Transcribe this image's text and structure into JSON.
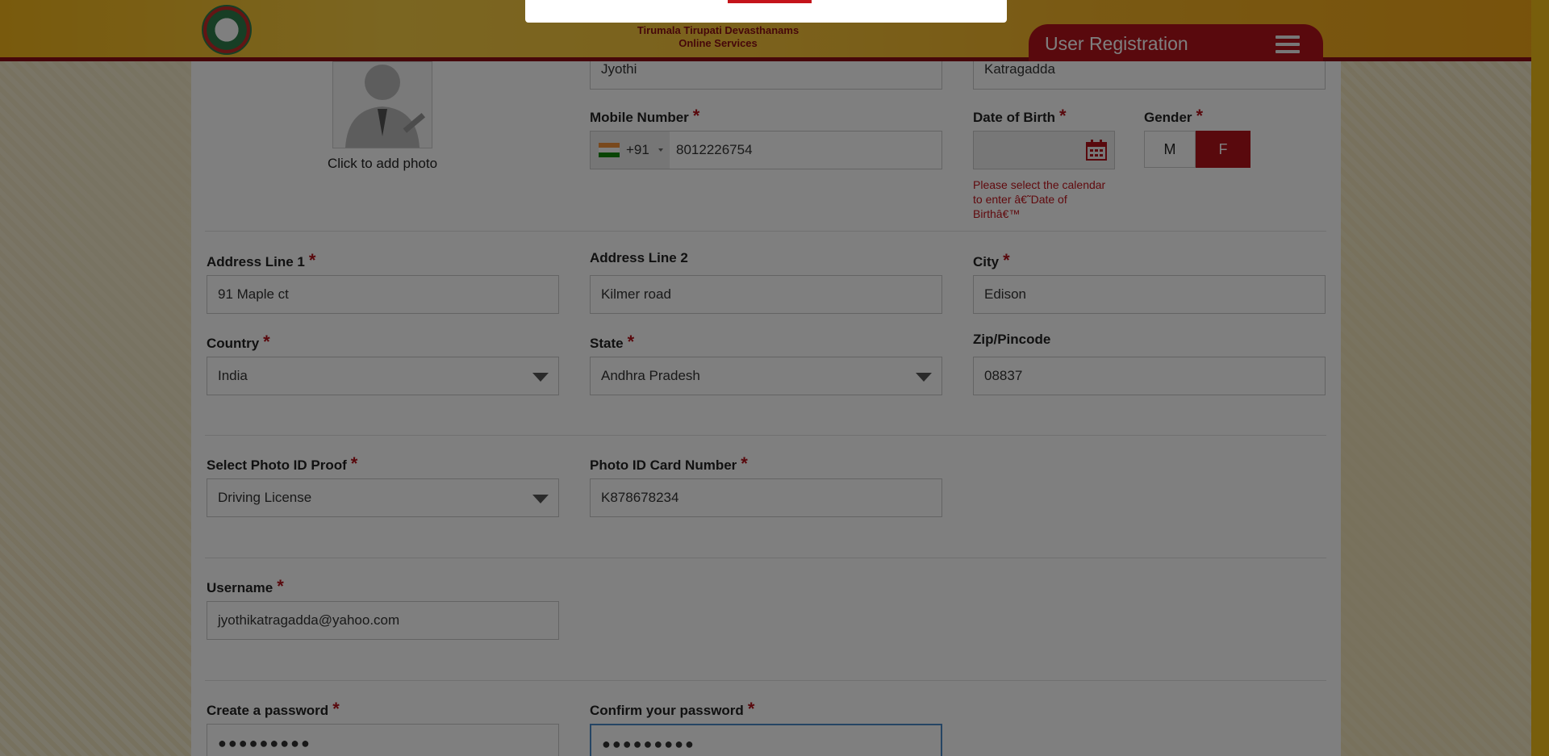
{
  "header": {
    "org_line1": "Tirumala Tirupati Devasthanams",
    "org_line2": "Online Services",
    "page_title": "User Registration"
  },
  "photo": {
    "caption": "Click to add photo"
  },
  "form": {
    "first_name_value": "Jyothi",
    "last_name_value": "Katragadda",
    "mobile_label": "Mobile Number",
    "country_code": "+91",
    "mobile_value": "8012226754",
    "dob_label": "Date of Birth",
    "dob_error": "Please select the calendar to enter â€˜Date of Birthâ€™",
    "gender_label": "Gender",
    "gender_m": "M",
    "gender_f": "F",
    "address1_label": "Address Line 1",
    "address1_value": "91 Maple ct",
    "address2_label": "Address Line 2",
    "address2_value": "Kilmer road",
    "city_label": "City",
    "city_value": "Edison",
    "country_label": "Country",
    "country_value": "India",
    "state_label": "State",
    "state_value": "Andhra Pradesh",
    "zip_label": "Zip/Pincode",
    "zip_value": "08837",
    "id_proof_label": "Select Photo ID Proof",
    "id_proof_value": "Driving License",
    "id_number_label": "Photo ID Card Number",
    "id_number_value": "K878678234",
    "username_label": "Username",
    "username_value": "jyothikatragadda@yahoo.com",
    "password_label": "Create a password",
    "password_value": "●●●●●●●●●",
    "confirm_label": "Confirm your password",
    "confirm_value": "●●●●●●●●●",
    "required_mark": "*"
  }
}
